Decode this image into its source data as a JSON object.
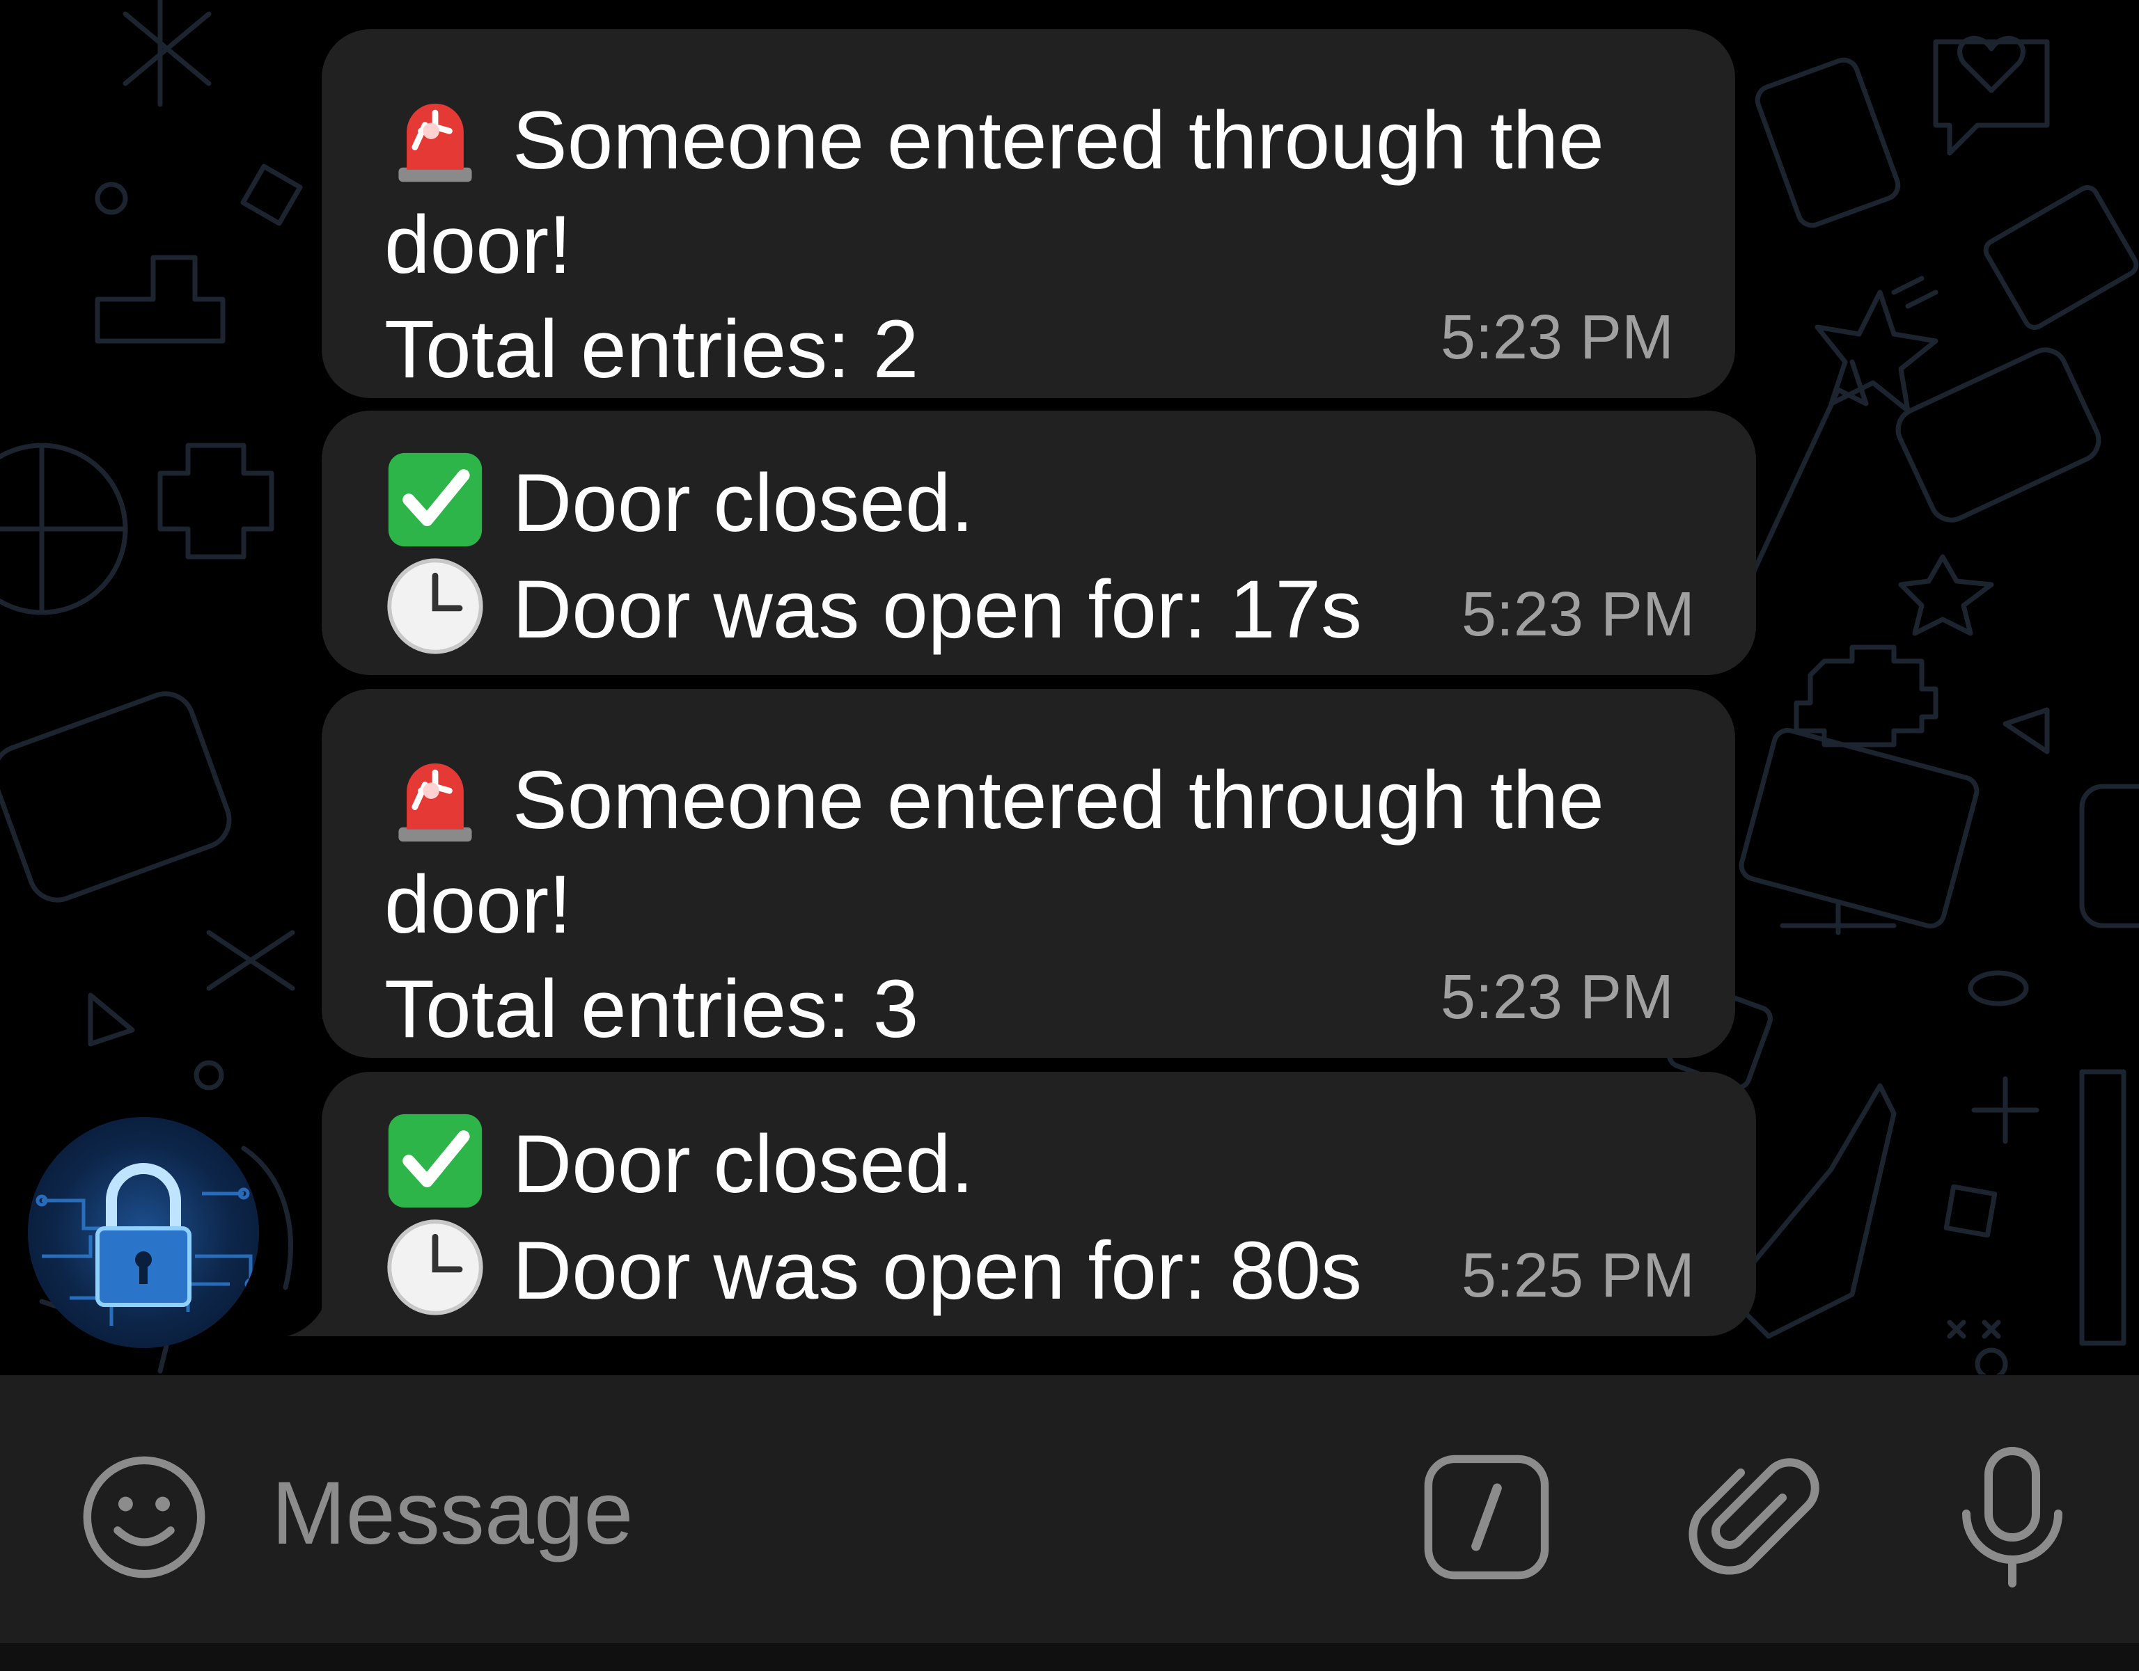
{
  "messages": [
    {
      "icon": "rotating-light-icon",
      "lines": [
        "Someone entered through the door!",
        "Total entries: 2"
      ],
      "time": "5:23 PM"
    },
    {
      "lines": [
        {
          "icon": "check-mark-button-icon",
          "text": "Door closed."
        },
        {
          "icon": "clock-icon",
          "text": "Door was open for: 17s"
        }
      ],
      "time": "5:23 PM"
    },
    {
      "icon": "rotating-light-icon",
      "lines": [
        "Someone entered through the door!",
        "Total entries: 3"
      ],
      "time": "5:23 PM"
    },
    {
      "lines": [
        {
          "icon": "check-mark-button-icon",
          "text": "Door closed."
        },
        {
          "icon": "clock-icon",
          "text": "Door was open for: 80s"
        }
      ],
      "time": "5:25 PM"
    }
  ],
  "composer": {
    "placeholder": "Message",
    "icons": [
      "emoji-icon",
      "bot-commands-icon",
      "attach-icon",
      "microphone-icon"
    ]
  },
  "sender": {
    "avatar_icon": "padlock-icon"
  },
  "colors": {
    "background": "#000000",
    "bubble": "#212121",
    "text": "#ffffff",
    "timestamp": "#a0a0a0",
    "composer": "#1e1e1e",
    "composer_icons": "#8c8c8c",
    "check_green": "#2db54a",
    "siren_red": "#e53935"
  }
}
